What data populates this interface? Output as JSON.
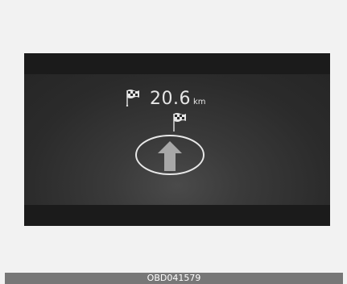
{
  "navigation": {
    "distance_value": "20.6",
    "distance_unit": "km",
    "direction": "straight-ahead",
    "destination_icon": "checkered-flag-icon"
  },
  "caption": {
    "code": "OBD041579"
  },
  "colors": {
    "page_background": "#f2f2f2",
    "display_background": "#2a2a2a",
    "band": "#1b1b1b",
    "text": "#e6e6e6",
    "arrow": "#a8a8a8",
    "caption_bar": "#777777"
  }
}
